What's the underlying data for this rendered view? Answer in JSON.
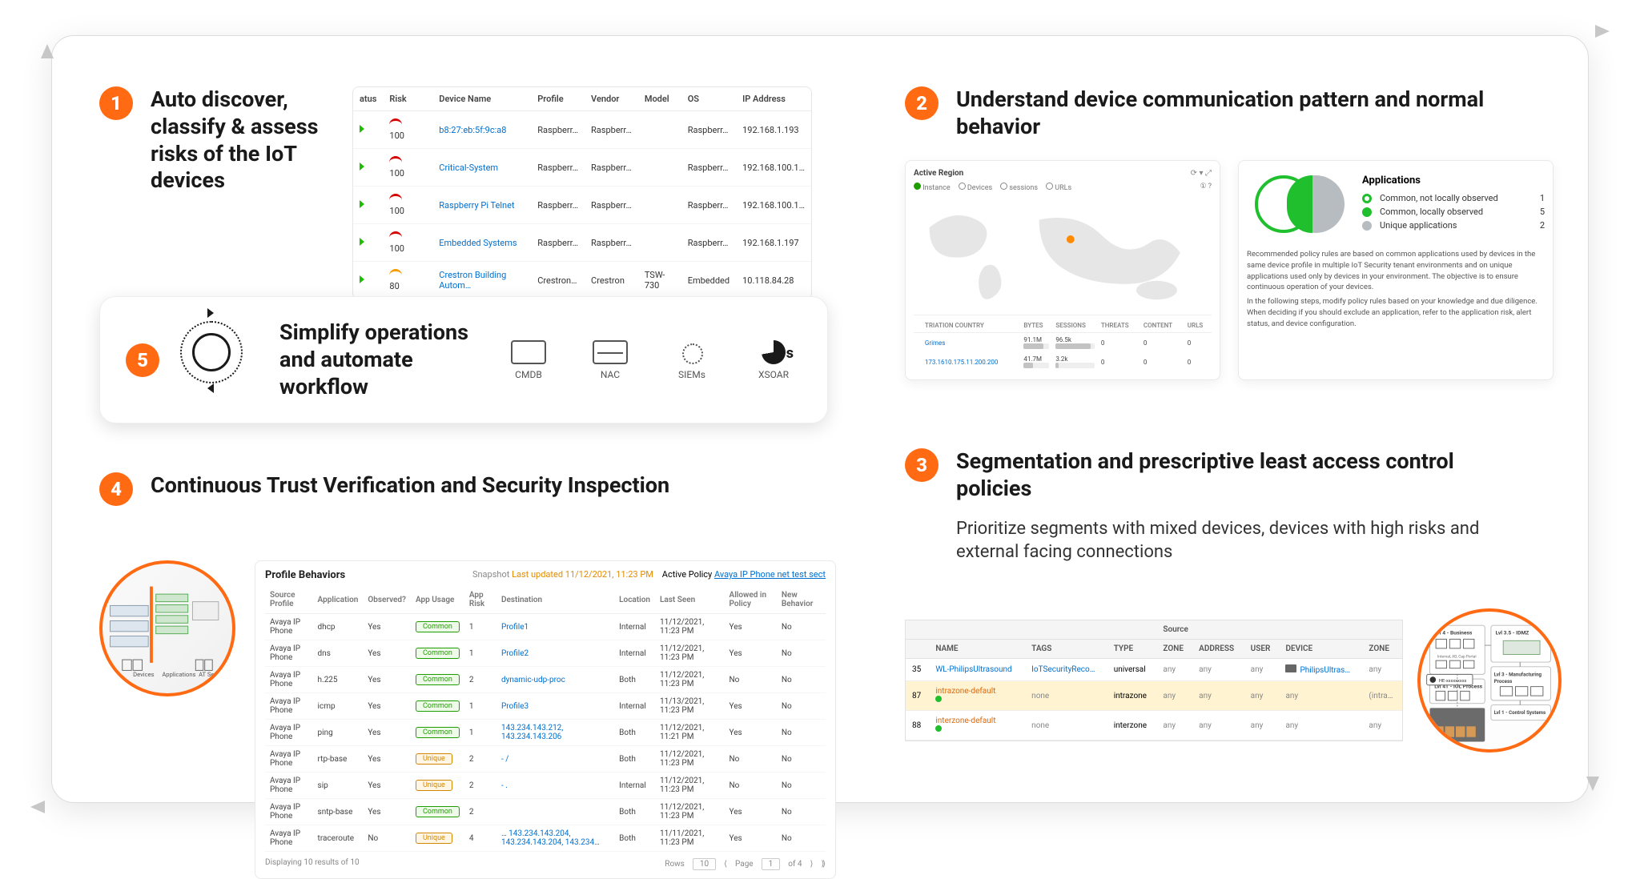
{
  "steps": {
    "s1": {
      "num": "1",
      "title": "Auto discover, classify & assess risks of the IoT devices"
    },
    "s2": {
      "num": "2",
      "title": "Understand device communication pattern and normal behavior"
    },
    "s3": {
      "num": "3",
      "title": "Segmentation and prescriptive least access control policies",
      "subtitle": "Prioritize segments with mixed devices, devices with high risks and external facing connections"
    },
    "s4": {
      "num": "4",
      "title": "Continuous Trust Verification and Security Inspection"
    },
    "s5": {
      "num": "5",
      "title": "Simplify operations and automate workflow"
    }
  },
  "device_table": {
    "headers": [
      "atus",
      "Risk",
      "",
      "Device Name",
      "Profile",
      "Vendor",
      "Model",
      "OS",
      "IP Address"
    ],
    "rows": [
      {
        "risk": "100",
        "gauge": "red",
        "name": "b8:27:eb:5f:9c:a8",
        "profile": "Raspberr…",
        "vendor": "Raspberr…",
        "model": "",
        "os": "Raspberr…",
        "ip": "192.168.1.193"
      },
      {
        "risk": "100",
        "gauge": "red",
        "name": "Critical-System",
        "profile": "Raspberr…",
        "vendor": "Raspberr…",
        "model": "",
        "os": "Raspberr…",
        "ip": "192.168.100.1…"
      },
      {
        "risk": "100",
        "gauge": "red",
        "name": "Raspberry Pi Telnet",
        "profile": "Raspberr…",
        "vendor": "Raspberr…",
        "model": "",
        "os": "Raspberr…",
        "ip": "192.168.100.1…"
      },
      {
        "risk": "100",
        "gauge": "red",
        "name": "Embedded Systems",
        "profile": "Raspberr…",
        "vendor": "Raspberr…",
        "model": "",
        "os": "Raspberr…",
        "ip": "192.168.1.197"
      },
      {
        "risk": "80",
        "gauge": "orange",
        "name": "Crestron Building Autom…",
        "profile": "Crestron…",
        "vendor": "Crestron",
        "model": "TSW-730",
        "os": "Embedded",
        "ip": "10.118.84.28"
      }
    ]
  },
  "tools": [
    {
      "label": "CMDB",
      "kind": "cmdb"
    },
    {
      "label": "NAC",
      "kind": "nac"
    },
    {
      "label": "SIEMs",
      "kind": "siem"
    },
    {
      "label": "XSOAR",
      "kind": "xsoar"
    }
  ],
  "map_card": {
    "title": "Active Region",
    "radios": [
      "Instance",
      "Devices",
      "sessions",
      "URLs"
    ],
    "columns": [
      "",
      "TRIATION COUNTRY",
      "BYTES",
      "SESSIONS",
      "THREATS",
      "CONTENT",
      "URLS"
    ],
    "rows": [
      {
        "country": "Grimes",
        "bytes": "91.1M",
        "bytes_pct": 78,
        "sessions": "96.5k",
        "sessions_pct": 90,
        "threats": "0",
        "content": "0",
        "urls": "0"
      },
      {
        "country": "173.1610.175.11.200.200",
        "bytes": "41.7M",
        "bytes_pct": 36,
        "sessions": "3.2k",
        "sessions_pct": 8,
        "threats": "0",
        "content": "0",
        "urls": "0"
      }
    ]
  },
  "venn_card": {
    "heading": "Applications",
    "legend": [
      {
        "kind": "ring",
        "label": "Common, not locally observed",
        "count": "1"
      },
      {
        "kind": "fill",
        "label": "Common, locally observed",
        "count": "5"
      },
      {
        "kind": "gray",
        "label": "Unique applications",
        "count": "2"
      }
    ],
    "para1": "Recommended policy rules are based on common applications used by devices in the same device profile in multiple IoT Security tenant environments and on unique applications used only by devices in your environment. The objective is to ensure continuous operation of your devices.",
    "para2": "In the following steps, modify policy rules based on your knowledge and due diligence. When deciding if you should exclude an application, refer to the application risk, alert status, and device configuration."
  },
  "seg_table": {
    "group_source": "Source",
    "headers_top": [
      "",
      "NAME",
      "TAGS",
      "TYPE"
    ],
    "headers_src": [
      "ZONE",
      "ADDRESS",
      "USER",
      "DEVICE"
    ],
    "headers_dst": [
      "ZONE"
    ],
    "rows": [
      {
        "idx": "35",
        "name": "WL-PhilipsUltrasound",
        "tags": "IoTSecurityReco…",
        "type": "universal",
        "zone": "any",
        "addr": "any",
        "user": "any",
        "device": "PhilipsUltras…",
        "dzone": "any",
        "hl": false
      },
      {
        "idx": "87",
        "name": "intrazone-default",
        "dot": true,
        "tags": "none",
        "type": "intrazone",
        "zone": "any",
        "addr": "any",
        "user": "any",
        "device": "any",
        "dzone": "(intra…",
        "hl": true
      },
      {
        "idx": "88",
        "name": "interzone-default",
        "dot": true,
        "tags": "none",
        "type": "interzone",
        "zone": "any",
        "addr": "any",
        "user": "any",
        "device": "any",
        "dzone": "any",
        "hl": false
      }
    ]
  },
  "profile_behaviors": {
    "title": "Profile Behaviors",
    "snapshot_label": "Snapshot",
    "snapshot_value": "Last updated 11/12/2021, 11:23 PM",
    "active_policy_label": "Active Policy",
    "active_policy_value": "Avaya IP Phone net test sect",
    "columns": [
      "Source Profile",
      "Application",
      "Observed?",
      "App Usage",
      "App Risk",
      "Destination",
      "Location",
      "Last Seen",
      "Allowed in Policy",
      "New Behavior"
    ],
    "rows": [
      {
        "src": "Avaya IP Phone",
        "app": "dhcp",
        "obs": "Yes",
        "use": "Common",
        "risk": "1",
        "dest": "Profile1",
        "loc": "Internal",
        "seen": "11/12/2021, 11:23 PM",
        "allowed": "Yes",
        "new": "No"
      },
      {
        "src": "Avaya IP Phone",
        "app": "dns",
        "obs": "Yes",
        "use": "Common",
        "risk": "1",
        "dest": "Profile2",
        "loc": "Internal",
        "seen": "11/12/2021, 11:23 PM",
        "allowed": "Yes",
        "new": "No"
      },
      {
        "src": "Avaya IP Phone",
        "app": "h.225",
        "obs": "Yes",
        "use": "Common",
        "risk": "2",
        "dest": "dynamic-udp-proc",
        "loc": "Both",
        "seen": "11/12/2021, 11:23 PM",
        "allowed": "No",
        "new": "No"
      },
      {
        "src": "Avaya IP Phone",
        "app": "icmp",
        "obs": "Yes",
        "use": "Common",
        "risk": "1",
        "dest": "Profile3",
        "loc": "Internal",
        "seen": "11/13/2021, 11:23 PM",
        "allowed": "Yes",
        "new": "No"
      },
      {
        "src": "Avaya IP Phone",
        "app": "ping",
        "obs": "Yes",
        "use": "Common",
        "risk": "1",
        "dest": "143.234.143.212, 143.234.143.206",
        "loc": "Both",
        "seen": "11/12/2021, 11:21 PM",
        "allowed": "Yes",
        "new": "No"
      },
      {
        "src": "Avaya IP Phone",
        "app": "rtp-base",
        "obs": "Yes",
        "use": "Unique",
        "risk": "2",
        "dest": "- /",
        "loc": "Both",
        "seen": "11/12/2021, 11:23 PM",
        "allowed": "No",
        "new": "No"
      },
      {
        "src": "Avaya IP Phone",
        "app": "sip",
        "obs": "Yes",
        "use": "Unique",
        "risk": "2",
        "dest": "- .",
        "loc": "Internal",
        "seen": "11/12/2021, 11:23 PM",
        "allowed": "No",
        "new": "No"
      },
      {
        "src": "Avaya IP Phone",
        "app": "sntp-base",
        "obs": "Yes",
        "use": "Common",
        "risk": "2",
        "dest": "",
        "loc": "Both",
        "seen": "11/12/2021, 11:23 PM",
        "allowed": "Yes",
        "new": "No"
      },
      {
        "src": "Avaya IP Phone",
        "app": "traceroute",
        "obs": "No",
        "use": "Unique",
        "risk": "4",
        "dest": "… 143.234.143.204, 143.234.143.204, 143.234…",
        "loc": "Both",
        "seen": "11/11/2021, 11:23 PM",
        "allowed": "Yes",
        "new": "No"
      }
    ],
    "footer": {
      "display": "Displaying 10 results of 10",
      "rows_label": "Rows",
      "rows_val": "10",
      "page_label": "Page",
      "page_val": "1",
      "page_of": "of 4"
    }
  }
}
